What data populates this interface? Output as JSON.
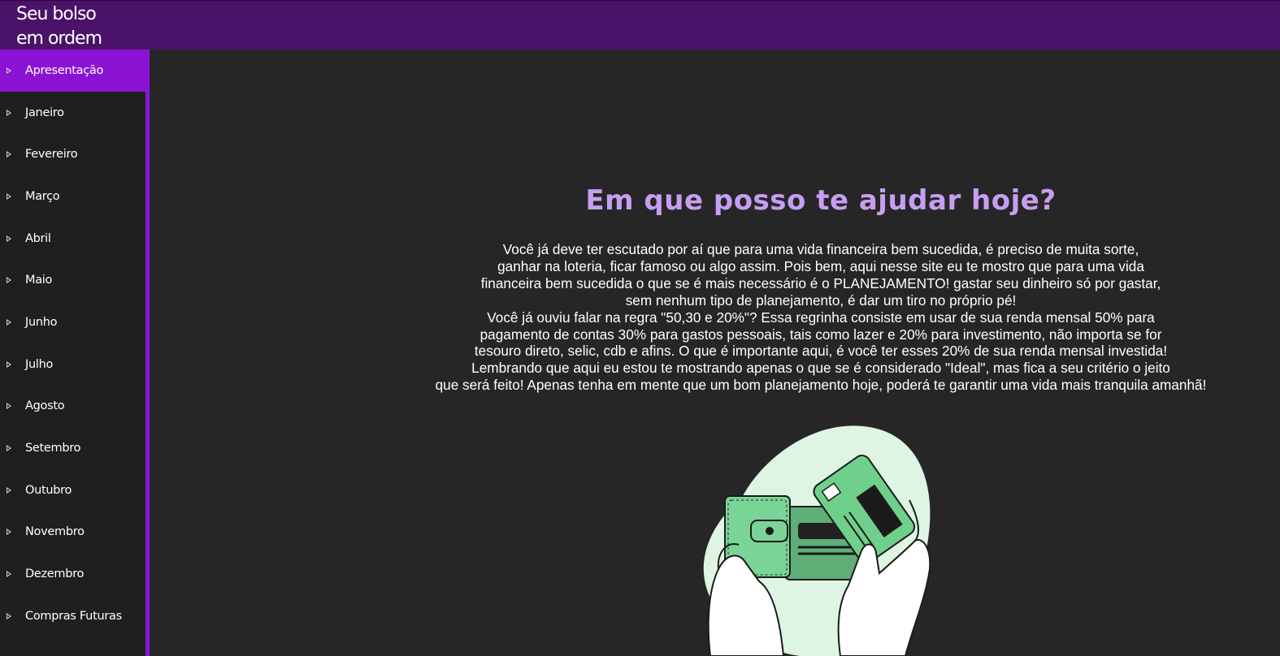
{
  "header": {
    "brand_line1": "Seu bolso",
    "brand_line2": "em ordem"
  },
  "sidebar": {
    "items": [
      {
        "label": "Apresentação",
        "active": true
      },
      {
        "label": "Janeiro"
      },
      {
        "label": "Fevereiro"
      },
      {
        "label": "Março"
      },
      {
        "label": "Abril"
      },
      {
        "label": "Maio"
      },
      {
        "label": "Junho"
      },
      {
        "label": "Julho"
      },
      {
        "label": "Agosto"
      },
      {
        "label": "Setembro"
      },
      {
        "label": "Outubro"
      },
      {
        "label": "Novembro"
      },
      {
        "label": "Dezembro"
      },
      {
        "label": "Compras Futuras"
      }
    ]
  },
  "main": {
    "title": "Em que posso te ajudar hoje?",
    "lines": [
      "Você já deve ter escutado por aí que para uma vida financeira bem sucedida, é preciso de muita sorte,",
      "ganhar na loteria, ficar famoso ou algo assim. Pois bem, aqui nesse site eu te mostro que para uma vida",
      "financeira bem sucedida o que se é mais necessário é o PLANEJAMENTO! gastar seu dinheiro só por gastar,",
      "sem nenhum tipo de planejamento, é dar um tiro no próprio pé!",
      "Você já ouviu falar na regra \"50,30 e 20%\"? Essa regrinha consiste em usar de sua renda mensal 50% para",
      "pagamento de contas 30% para gastos pessoais, tais como lazer e 20% para investimento, não importa se for",
      "tesouro direto, selic, cdb e afins. O que é importante aqui, é você ter esses 20% de sua renda mensal investida!",
      "Lembrando que aqui eu estou te mostrando apenas o que se é considerado \"Ideal\", mas fica a seu critério o jeito",
      "que será feito! Apenas tenha em mente que um bom planejamento hoje, poderá te garantir uma vida mais tranquila amanhã!"
    ],
    "illustration_icon": "wallet-credit-card-illustration"
  },
  "colors": {
    "header_bg": "#4a1268",
    "accent": "#8b14d4",
    "sidebar_bg": "#1f1f1f",
    "page_bg": "#272627",
    "title": "#c79ef2",
    "illustration_green": "#6fd08c"
  }
}
